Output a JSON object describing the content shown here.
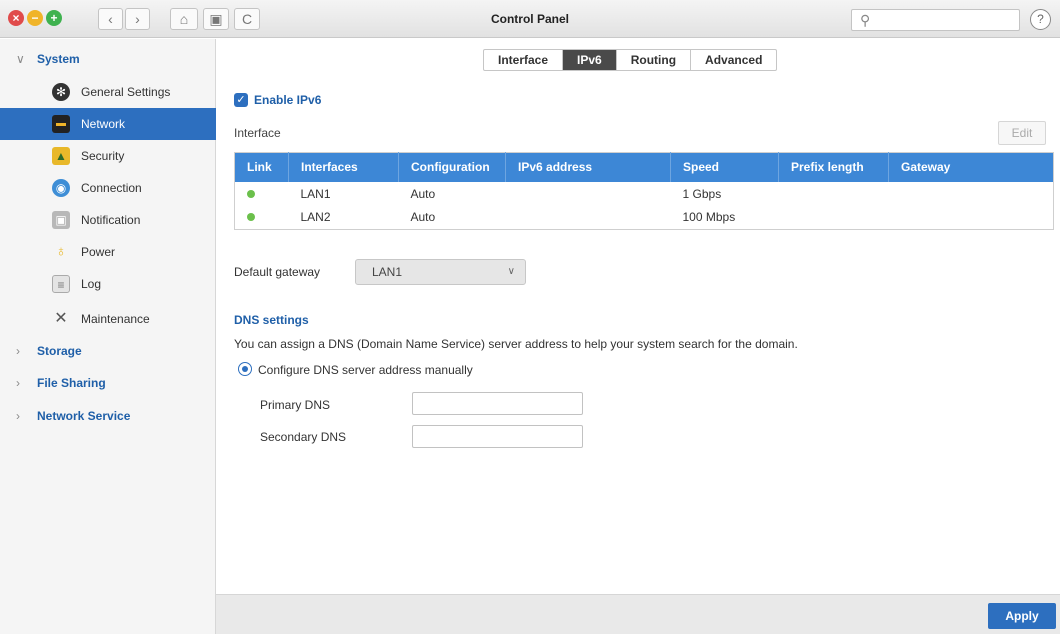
{
  "window": {
    "title": "Control Panel",
    "search_placeholder": "",
    "help_symbol": "?"
  },
  "toolbar": {
    "back": "‹",
    "forward": "›",
    "home": "⌂",
    "panel": "▣",
    "refresh": "C"
  },
  "sidebar": {
    "categories": [
      {
        "label": "System",
        "expanded": true
      },
      {
        "label": "Storage",
        "expanded": false
      },
      {
        "label": "File Sharing",
        "expanded": false
      },
      {
        "label": "Network Service",
        "expanded": false
      }
    ],
    "items": [
      {
        "label": "General Settings",
        "icon": "gear-icon"
      },
      {
        "label": "Network",
        "icon": "network-card-icon",
        "active": true
      },
      {
        "label": "Security",
        "icon": "lock-icon"
      },
      {
        "label": "Connection",
        "icon": "globe-icon"
      },
      {
        "label": "Notification",
        "icon": "notification-icon"
      },
      {
        "label": "Power",
        "icon": "bulb-icon"
      },
      {
        "label": "Log",
        "icon": "log-icon"
      },
      {
        "label": "Maintenance",
        "icon": "tools-icon"
      }
    ]
  },
  "tabs": [
    {
      "label": "Interface"
    },
    {
      "label": "IPv6",
      "active": true
    },
    {
      "label": "Routing"
    },
    {
      "label": "Advanced"
    }
  ],
  "ipv6": {
    "enable_label": "Enable IPv6",
    "enabled": true,
    "interface_heading": "Interface",
    "edit_label": "Edit",
    "columns": [
      "Link",
      "Interfaces",
      "Configuration",
      "IPv6 address",
      "Speed",
      "Prefix length",
      "Gateway"
    ],
    "rows": [
      {
        "link": "up",
        "interface": "LAN1",
        "configuration": "Auto",
        "ipv6": "",
        "speed": "1 Gbps",
        "prefix": "",
        "gateway": ""
      },
      {
        "link": "up",
        "interface": "LAN2",
        "configuration": "Auto",
        "ipv6": "",
        "speed": "100 Mbps",
        "prefix": "",
        "gateway": ""
      }
    ],
    "default_gateway_label": "Default gateway",
    "default_gateway_value": "LAN1"
  },
  "dns": {
    "heading": "DNS settings",
    "description": "You can assign a DNS (Domain Name Service) server address to help your system search for the domain.",
    "manual_label": "Configure DNS server address manually",
    "primary_label": "Primary DNS",
    "primary_value": "",
    "secondary_label": "Secondary DNS",
    "secondary_value": ""
  },
  "footer": {
    "apply_label": "Apply"
  },
  "colors": {
    "accent": "#2d6fbf",
    "table_header": "#3d87d6",
    "link_up": "#6bc04b"
  }
}
